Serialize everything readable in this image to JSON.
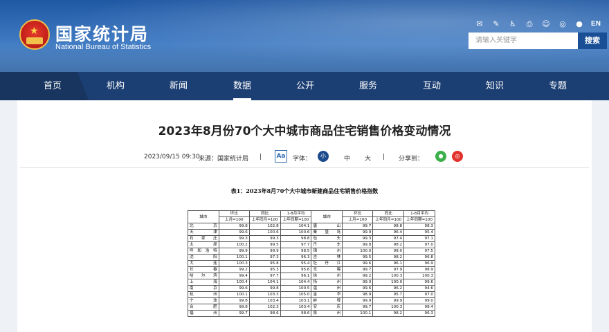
{
  "header": {
    "logo_cn": "国家统计局",
    "logo_en": "National Bureau of Statistics",
    "toolbar_icons": [
      "mail-icon",
      "edit-icon",
      "accessibility-icon",
      "print-icon",
      "mobile-icon",
      "weibo-icon",
      "wechat-icon"
    ],
    "lang_label": "EN",
    "search": {
      "placeholder": "请输入关键字",
      "button_label": "搜索"
    }
  },
  "nav": {
    "items": [
      {
        "label": "首页"
      },
      {
        "label": "机构"
      },
      {
        "label": "新闻"
      },
      {
        "label": "数据"
      },
      {
        "label": "公开"
      },
      {
        "label": "服务"
      },
      {
        "label": "互动"
      },
      {
        "label": "知识"
      },
      {
        "label": "专题"
      }
    ],
    "active": "数据"
  },
  "article": {
    "title": "2023年8月份70个大中城市商品住宅销售价格变动情况",
    "datetime": "2023/09/15 09:30",
    "source": "来源：国家统计局",
    "sep": "|",
    "font_label": "字体：",
    "font_aa": "Aa",
    "font_small": "小",
    "font_medium": "中",
    "font_large": "大",
    "share_label": "分享到：",
    "share_wechat_icon": "wechat-icon",
    "share_weibo_icon": "weibo-icon"
  },
  "table": {
    "caption": "表1：2023年8月70个大中城市新建商品住宅销售价格指数",
    "headers": {
      "city": "城市",
      "mom": "环比",
      "yoy": "同比",
      "avg": "1-8月平均",
      "mom_sub": "上月=100",
      "yoy_sub": "上年同月=100",
      "avg_sub": "上年同期=100"
    },
    "rows": [
      {
        "left": [
          "北　　京",
          "99.8",
          "102.8",
          "104.1"
        ],
        "right": [
          "唐　　山",
          "99.7",
          "98.8",
          "98.3"
        ]
      },
      {
        "left": [
          "天　　津",
          "99.6",
          "100.6",
          "100.6"
        ],
        "right": [
          "秦 皇 岛",
          "99.9",
          "96.4",
          "95.4"
        ]
      },
      {
        "left": [
          "石 家 庄",
          "99.3",
          "99.3",
          "98.8"
        ],
        "right": [
          "包　　头",
          "99.3",
          "97.4",
          "97.1"
        ]
      },
      {
        "left": [
          "太　　原",
          "100.2",
          "99.5",
          "97.7"
        ],
        "right": [
          "丹　　东",
          "99.8",
          "98.2",
          "97.0"
        ]
      },
      {
        "left": [
          "呼和浩特",
          "99.9",
          "99.9",
          "98.5"
        ],
        "right": [
          "锦　　州",
          "100.0",
          "98.0",
          "97.5"
        ]
      },
      {
        "left": [
          "沈　　阳",
          "100.1",
          "97.3",
          "96.3"
        ],
        "right": [
          "吉　　林",
          "99.5",
          "98.2",
          "96.8"
        ]
      },
      {
        "left": [
          "大　　连",
          "100.3",
          "95.8",
          "95.4"
        ],
        "right": [
          "牡 丹 江",
          "99.6",
          "96.1",
          "96.9"
        ]
      },
      {
        "left": [
          "长　　春",
          "99.2",
          "95.3",
          "95.6"
        ],
        "right": [
          "无　　锡",
          "99.7",
          "97.9",
          "98.9"
        ]
      },
      {
        "left": [
          "哈 尔 滨",
          "99.4",
          "97.7",
          "96.1"
        ],
        "right": [
          "徐　　州",
          "99.2",
          "100.3",
          "100.3"
        ]
      },
      {
        "left": [
          "上　　海",
          "100.4",
          "104.1",
          "104.4"
        ],
        "right": [
          "扬　　州",
          "99.0",
          "100.0",
          "99.6"
        ]
      },
      {
        "left": [
          "南　　京",
          "99.6",
          "99.8",
          "100.5"
        ],
        "right": [
          "温　　州",
          "99.6",
          "96.2",
          "94.6"
        ]
      },
      {
        "left": [
          "杭　　州",
          "100.1",
          "103.3",
          "105.0"
        ],
        "right": [
          "金　　华",
          "98.9",
          "95.7",
          "97.0"
        ]
      },
      {
        "left": [
          "宁　　波",
          "99.8",
          "103.4",
          "103.1"
        ],
        "right": [
          "蚌　　埠",
          "99.9",
          "99.9",
          "99.0"
        ]
      },
      {
        "left": [
          "合　　肥",
          "99.8",
          "102.3",
          "103.4"
        ],
        "right": [
          "安　　庆",
          "99.7",
          "100.3",
          "98.4"
        ]
      },
      {
        "left": [
          "福　　州",
          "99.7",
          "98.6",
          "98.6"
        ],
        "right": [
          "泉　　州",
          "100.1",
          "98.2",
          "96.3"
        ]
      }
    ]
  }
}
